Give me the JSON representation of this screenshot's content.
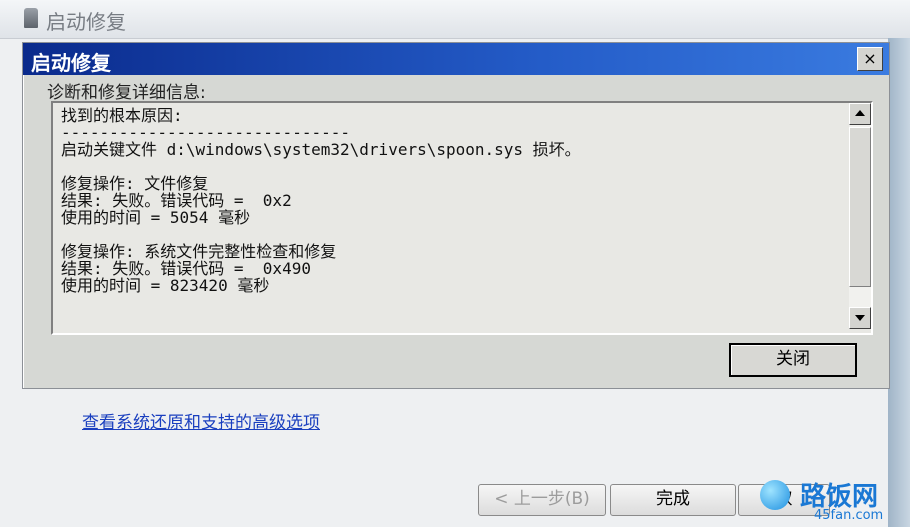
{
  "outer_window": {
    "title": "启动修复"
  },
  "dialog": {
    "title": "启动修复",
    "close_glyph": "×",
    "group_label": "诊断和修复详细信息:",
    "details": "找到的根本原因:\n------------------------------\n启动关键文件 d:\\windows\\system32\\drivers\\spoon.sys 损坏。\n\n修复操作: 文件修复\n结果: 失败。错误代码 =  0x2\n使用的时间 = 5054 毫秒\n\n修复操作: 系统文件完整性检查和修复\n结果: 失败。错误代码 =  0x490\n使用的时间 = 823420 毫秒",
    "close_button": "关闭"
  },
  "advanced_link": "查看系统还原和支持的高级选项",
  "footer": {
    "prev_button": "< 上一步(B)",
    "finish_button": "完成",
    "cancel_button": "取"
  },
  "watermark": {
    "text": "路饭网",
    "domain": "45fan.com"
  },
  "colors": {
    "title_blue": "#0a2a8c",
    "link_blue": "#1a3fbf"
  }
}
